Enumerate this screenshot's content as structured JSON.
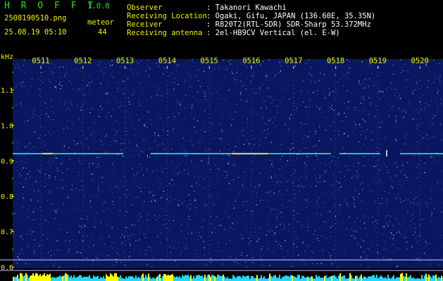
{
  "header": {
    "app_name": "H R O F F T",
    "version": "1.0.0",
    "filename": "2508190510.png",
    "datetime": "25.08.19 05:10",
    "meteor_label": "meteor",
    "meteor_count": "44",
    "info": [
      {
        "label": "Observer",
        "value": ": Takanori Kawachi"
      },
      {
        "label": "Receiving Location",
        "value": ": Ogaki, Gifu, JAPAN (136.60E, 35.35N)"
      },
      {
        "label": "Receiver",
        "value": ": R820T2(RTL-SDR) SDR-Sharp 53.372MHz"
      },
      {
        "label": "Receiving antenna",
        "value": ": 2el-HB9CV Vertical (el. E-W)"
      }
    ]
  },
  "chart_data": {
    "type": "heatmap",
    "ylabel": "kHz",
    "time_ticks": [
      "0511",
      "0512",
      "0513",
      "0514",
      "0515",
      "0516",
      "0517",
      "0518",
      "0519",
      "0520"
    ],
    "freq_ticks": [
      "1.1",
      "1.0",
      "0.9",
      "0.8",
      "0.7",
      "0.6"
    ],
    "freq_values": [
      1.1,
      1.0,
      0.9,
      0.8,
      0.7,
      0.6
    ],
    "carrier_khz": 0.92,
    "colors": {
      "background": "#0b1660",
      "noise": "#4a78ff",
      "carrier": "#40ffd0",
      "tick": "#f0f000",
      "strip_low": "#1fd8ff",
      "strip_high": "#ffff00"
    }
  }
}
